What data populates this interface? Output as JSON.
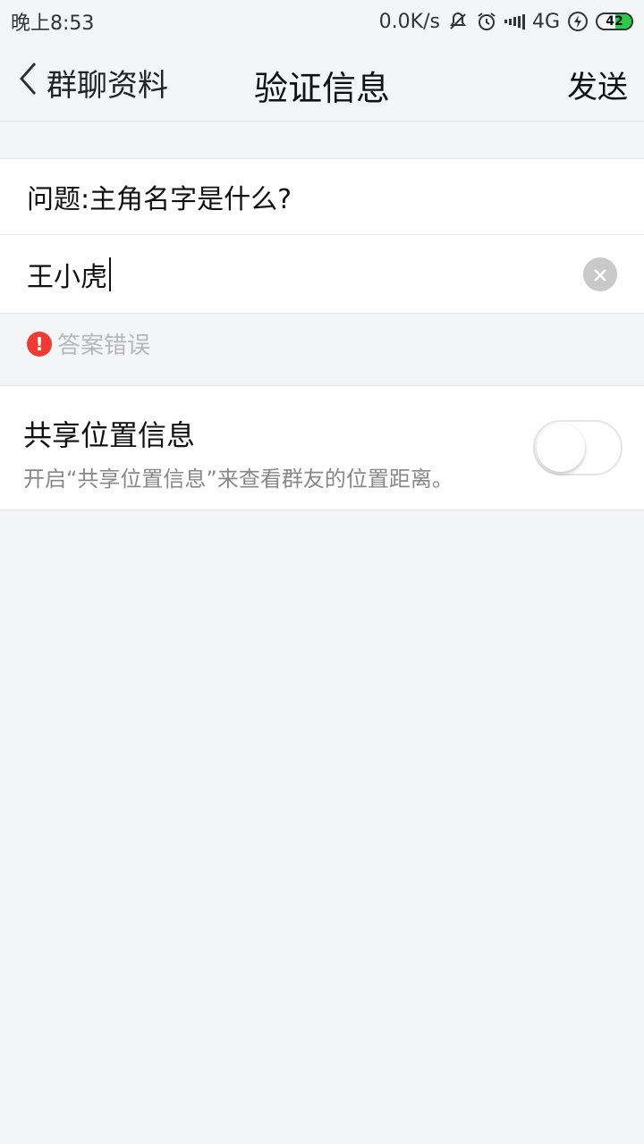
{
  "status_bar": {
    "time": "晚上8:53",
    "network_speed": "0.0K/s",
    "network_type": "4G",
    "battery_level": "42",
    "icons": [
      "mute-icon",
      "alarm-icon",
      "signal-icon",
      "charging-icon",
      "battery-icon"
    ]
  },
  "nav": {
    "back_label": "群聊资料",
    "title": "验证信息",
    "send_label": "发送"
  },
  "form": {
    "question": "问题:主角名字是什么?",
    "answer_value": "王小虎",
    "error_text": "答案错误"
  },
  "location": {
    "title": "共享位置信息",
    "description": "开启“共享位置信息”来查看群友的位置距离。",
    "enabled": false
  },
  "colors": {
    "error": "#ef3b33",
    "battery_fill": "#2cc94a",
    "background": "#f4f5f7"
  }
}
